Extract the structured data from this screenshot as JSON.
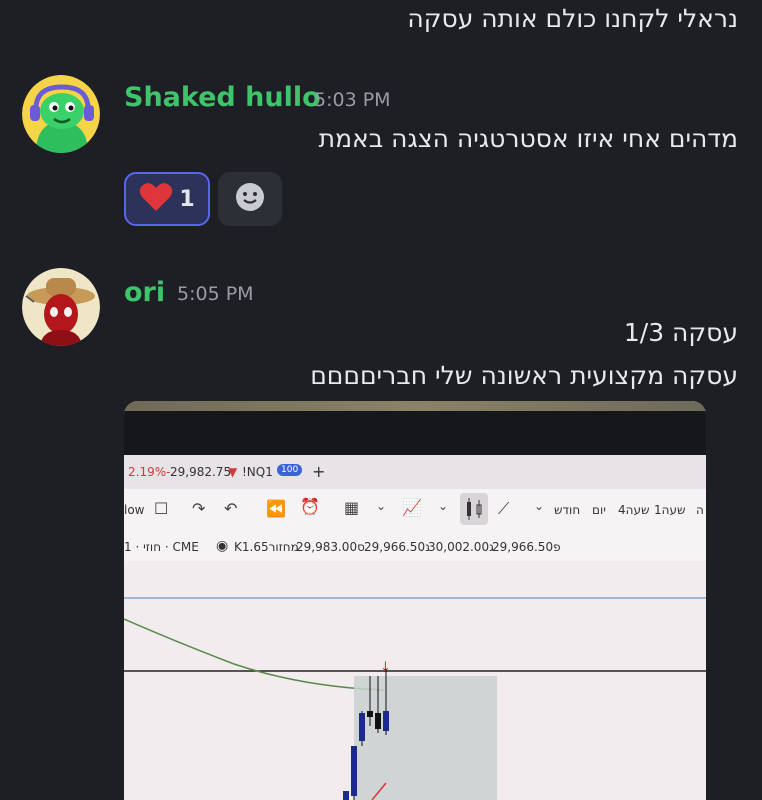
{
  "messages": [
    {
      "text": "נראלי לקחנו כולם אותה עסקה"
    },
    {
      "author": "Shaked hullo",
      "time": "5:03 PM",
      "avatar": "green-character-avatar",
      "text": "מדהים אחי איזו אסטרטגיה הצגה באמת",
      "reactions": [
        {
          "emoji": "❤️",
          "icon": "heart-icon",
          "count": "1"
        },
        {
          "icon": "add-reaction-smile-icon"
        }
      ]
    },
    {
      "author": "ori",
      "time": "5:05 PM",
      "avatar": "cowboy-hat-avatar",
      "lines": [
        "עסקה 1/3",
        "עסקה מקצועית ראשונה שלי חבריםםםם"
      ]
    }
  ],
  "photo": {
    "tab": {
      "change": "2.19%-",
      "price": "29,982.75",
      "arrow": "▼",
      "symbol": "!NQ1",
      "badge": "100",
      "plus": "+"
    },
    "toolbar": {
      "left_text": "low",
      "timeframes": [
        "יום",
        "חודש",
        "4שעה",
        "1שעה"
      ],
      "right_cut": "ה"
    },
    "info": {
      "left": "חוזי · 1 · CME",
      "volume": "K1.65מחזור",
      "close": "29,983.00ס",
      "low": "29,966.50נ",
      "high": "30,002.00ג",
      "open": "29,966.50פ"
    }
  },
  "colors": {
    "background": "#1e1f24",
    "username": "#3fc36b",
    "timestamp": "#9a9ca4",
    "reaction_active_border": "#5865f2"
  }
}
